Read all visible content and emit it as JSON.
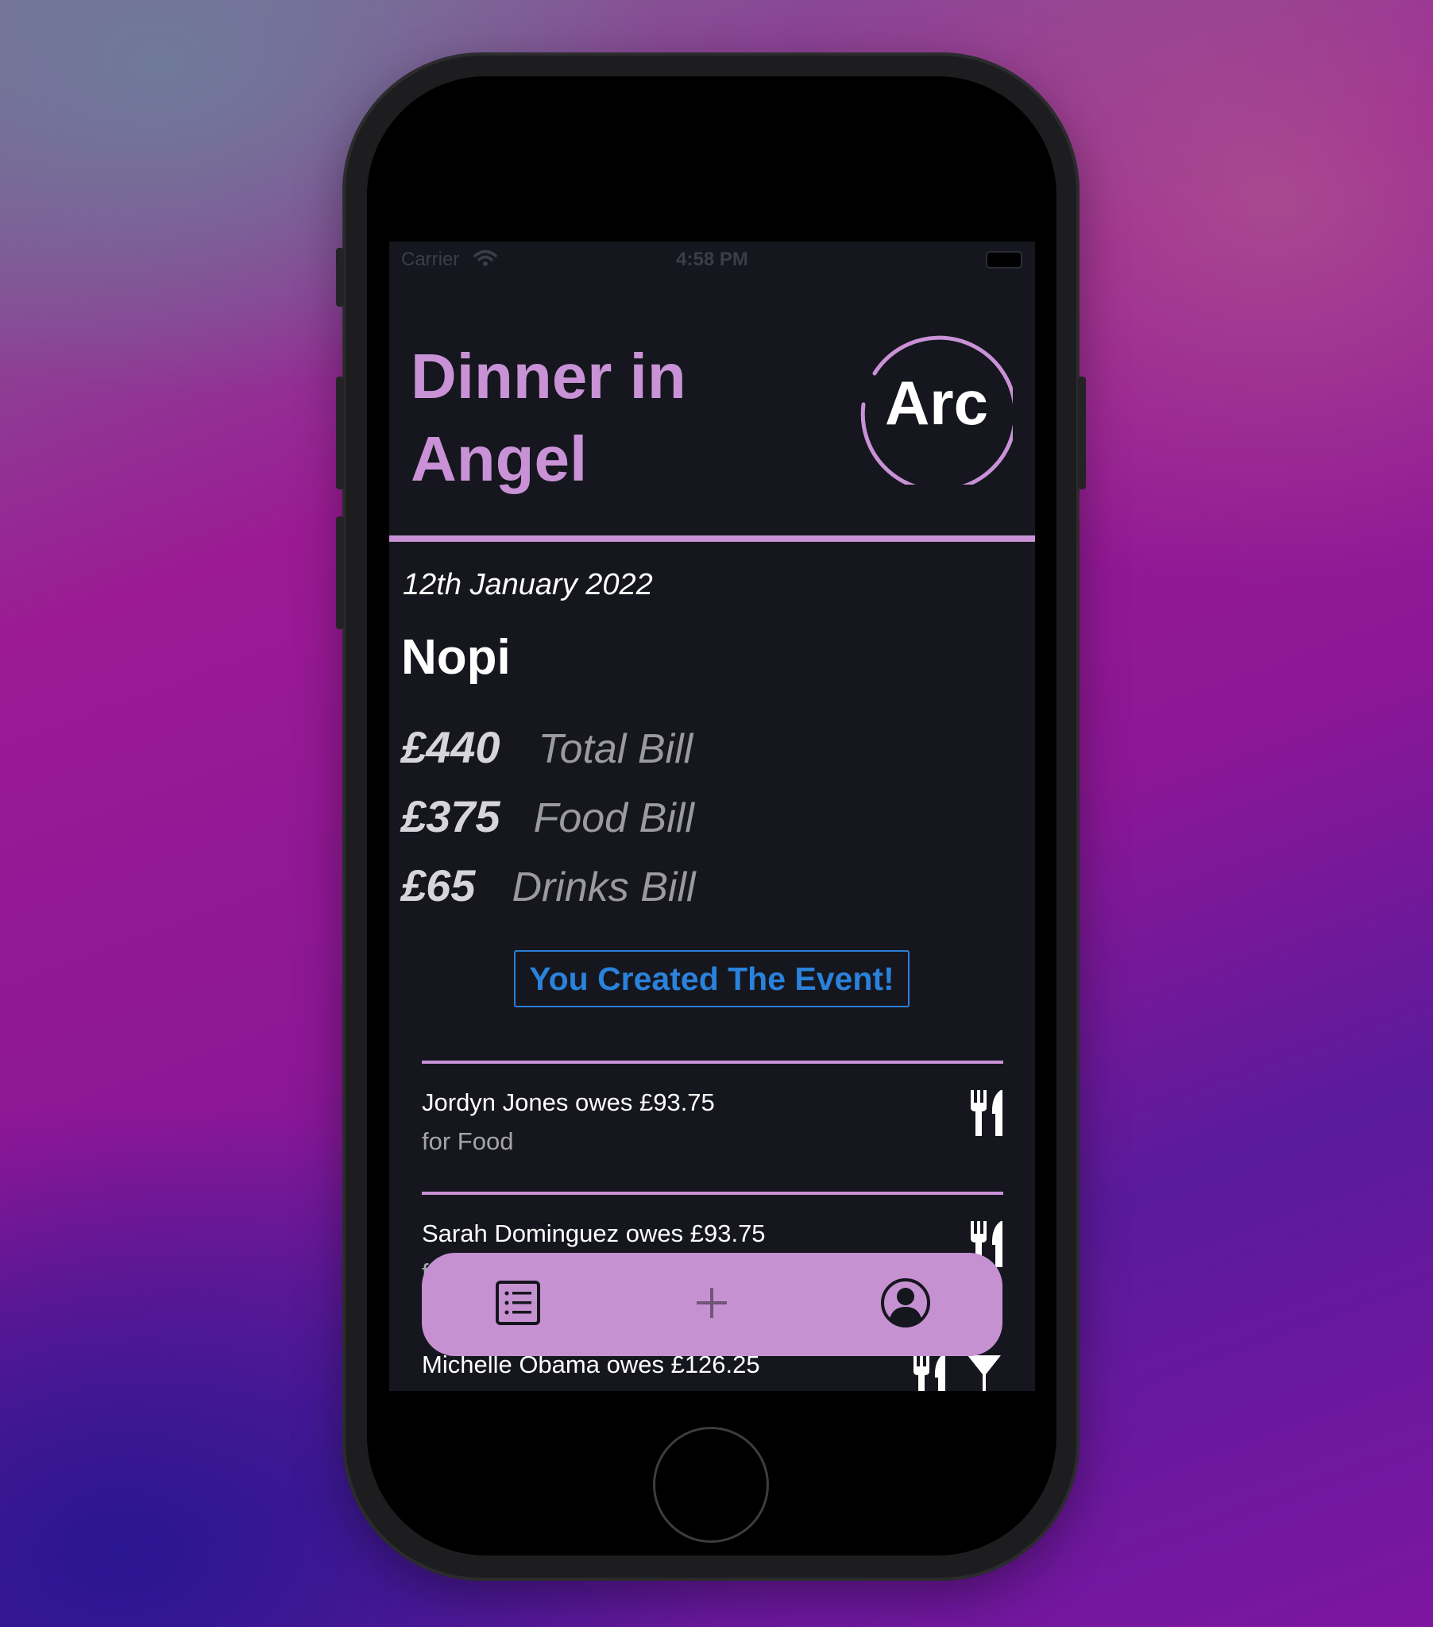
{
  "status_bar": {
    "carrier": "Carrier",
    "time": "4:58 PM"
  },
  "event": {
    "title": "Dinner in Angel",
    "logo_text": "Arc",
    "date": "12th January 2022",
    "venue": "Nopi"
  },
  "bills": [
    {
      "amount": "£440",
      "label": "Total Bill"
    },
    {
      "amount": "£375",
      "label": "Food Bill"
    },
    {
      "amount": "£65",
      "label": "Drinks Bill"
    }
  ],
  "creator_badge": "You Created The Event!",
  "owes": [
    {
      "text": "Jordyn Jones owes £93.75",
      "sub": "for Food",
      "icons": [
        "fork-knife-icon"
      ]
    },
    {
      "text": "Sarah Dominguez owes £93.75",
      "sub": "f",
      "icons": [
        "fork-knife-icon"
      ]
    },
    {
      "text": "Michelle Obama owes £126.25",
      "icons": [
        "fork-knife-icon",
        "cocktail-glass-icon"
      ]
    }
  ],
  "tab_bar": {
    "tabs": [
      {
        "name": "events",
        "icon": "list-icon"
      },
      {
        "name": "create",
        "icon": "plus-icon"
      },
      {
        "name": "profile",
        "icon": "person-circle-icon"
      }
    ]
  },
  "colors": {
    "accent": "#c992d6",
    "background": "#15161e",
    "badge_blue": "#2a82db",
    "tab_bar": "#c691d1"
  }
}
